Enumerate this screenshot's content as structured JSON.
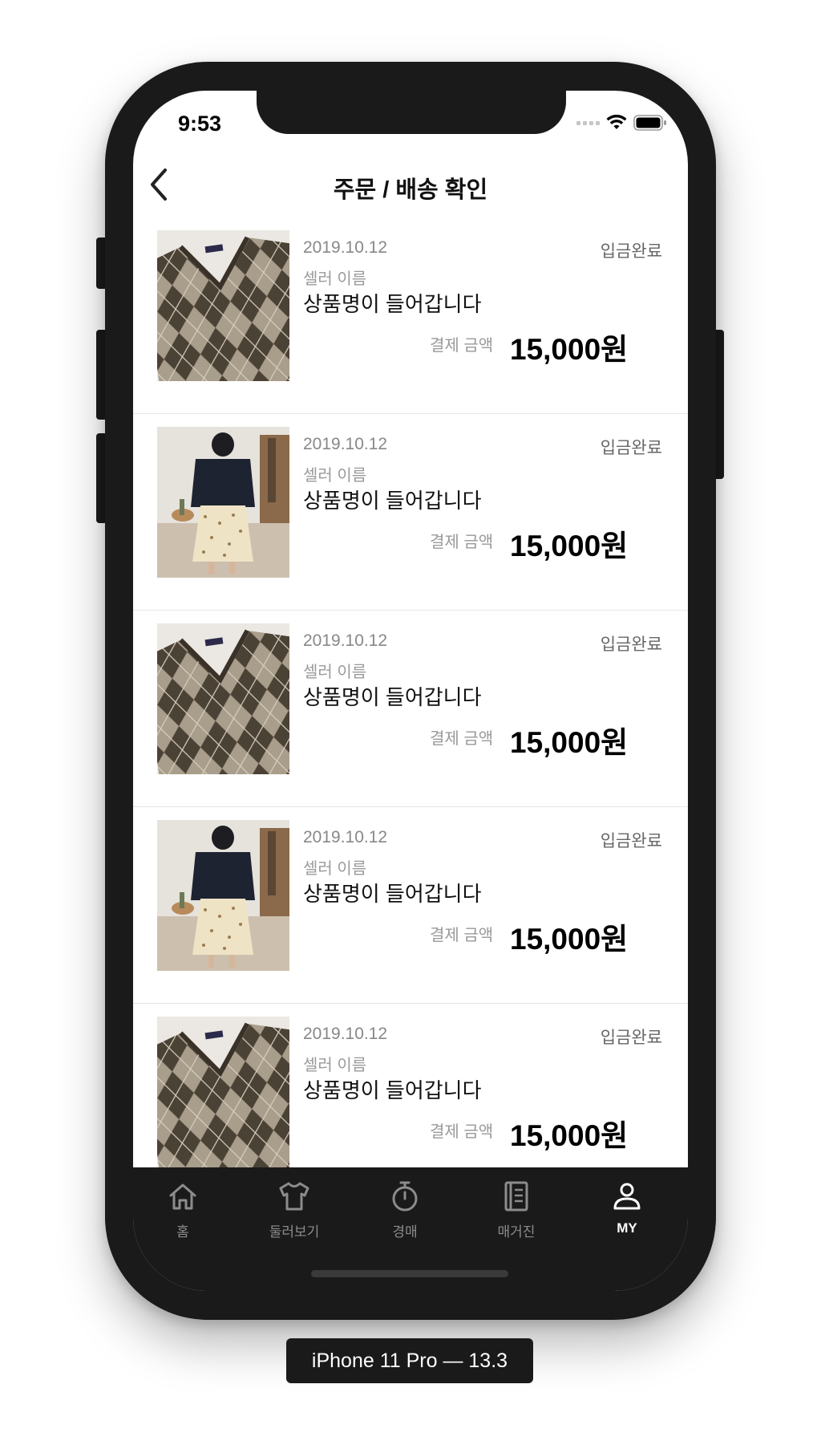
{
  "status_bar": {
    "time": "9:53",
    "icons": [
      "signal-dots-icon",
      "wifi-icon",
      "battery-icon"
    ]
  },
  "header": {
    "title": "주문 / 배송 확인",
    "back_icon": "chevron-left-icon"
  },
  "orders": [
    {
      "date": "2019.10.12",
      "status": "입금완료",
      "seller": "셀러 이름",
      "product": "상품명이 들어갑니다",
      "pay_label": "결제 금액",
      "amount": "15,000원",
      "image": "argyle-sweater"
    },
    {
      "date": "2019.10.12",
      "status": "입금완료",
      "seller": "셀러 이름",
      "product": "상품명이 들어갑니다",
      "pay_label": "결제 금액",
      "amount": "15,000원",
      "image": "model-outfit"
    },
    {
      "date": "2019.10.12",
      "status": "입금완료",
      "seller": "셀러 이름",
      "product": "상품명이 들어갑니다",
      "pay_label": "결제 금액",
      "amount": "15,000원",
      "image": "argyle-sweater"
    },
    {
      "date": "2019.10.12",
      "status": "입금완료",
      "seller": "셀러 이름",
      "product": "상품명이 들어갑니다",
      "pay_label": "결제 금액",
      "amount": "15,000원",
      "image": "model-outfit"
    },
    {
      "date": "2019.10.12",
      "status": "입금완료",
      "seller": "셀러 이름",
      "product": "상품명이 들어갑니다",
      "pay_label": "결제 금액",
      "amount": "15,000원",
      "image": "argyle-sweater"
    }
  ],
  "tabbar": {
    "tabs": [
      {
        "label": "홈",
        "icon": "home-icon",
        "active": false
      },
      {
        "label": "둘러보기",
        "icon": "tshirt-icon",
        "active": false
      },
      {
        "label": "경매",
        "icon": "stopwatch-icon",
        "active": false
      },
      {
        "label": "매거진",
        "icon": "magazine-icon",
        "active": false
      },
      {
        "label": "MY",
        "icon": "person-icon",
        "active": true
      }
    ]
  },
  "device_caption": "iPhone 11 Pro — 13.3",
  "colors": {
    "frame": "#1a1a1a",
    "tab_inactive": "#8c8c8c",
    "tab_active": "#ffffff",
    "muted_text": "#888888"
  }
}
